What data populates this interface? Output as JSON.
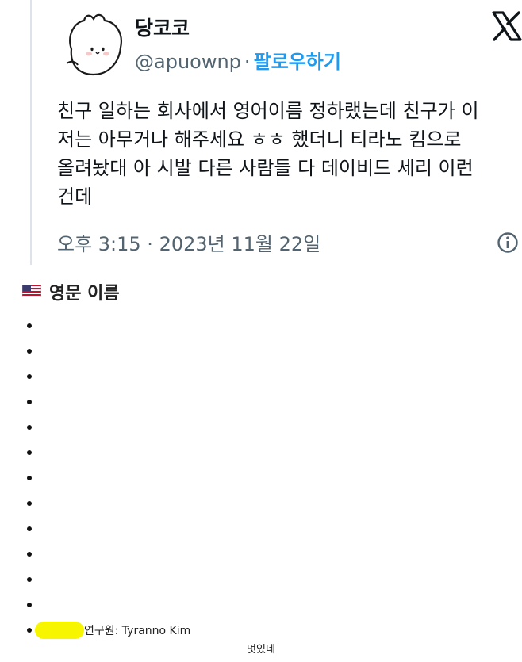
{
  "tweet": {
    "display_name": "당코코",
    "handle": "@apuownp",
    "separator": "·",
    "follow_label": "팔로우하기",
    "text": "친구 일하는 회사에서 영어이름 정하랬는데 친구가 이\n저는 아무거나 해주세요 ㅎㅎ 했더니 티라노 킴으로\n올려놨대 아 시발 다른 사람들 다 데이비드 세리 이런\n건데",
    "timestamp": "오후 3:15 · 2023년 11월 22일",
    "icons": {
      "logo": "x-logo-icon",
      "info": "info-icon",
      "avatar": "avatar-cartoon"
    },
    "colors": {
      "link": "#1d9bf0",
      "secondary_text": "#536471"
    }
  },
  "list": {
    "flag_icon": "us-flag-icon",
    "title": "영문 이름",
    "items": [
      {
        "text": ""
      },
      {
        "text": ""
      },
      {
        "text": ""
      },
      {
        "text": ""
      },
      {
        "text": ""
      },
      {
        "text": ""
      },
      {
        "text": ""
      },
      {
        "text": ""
      },
      {
        "text": ""
      },
      {
        "text": ""
      },
      {
        "text": ""
      },
      {
        "text": ""
      },
      {
        "text": "연구원: Tyranno Kim"
      }
    ],
    "highlight_color": "#f7f500"
  },
  "caption": "멋있네"
}
